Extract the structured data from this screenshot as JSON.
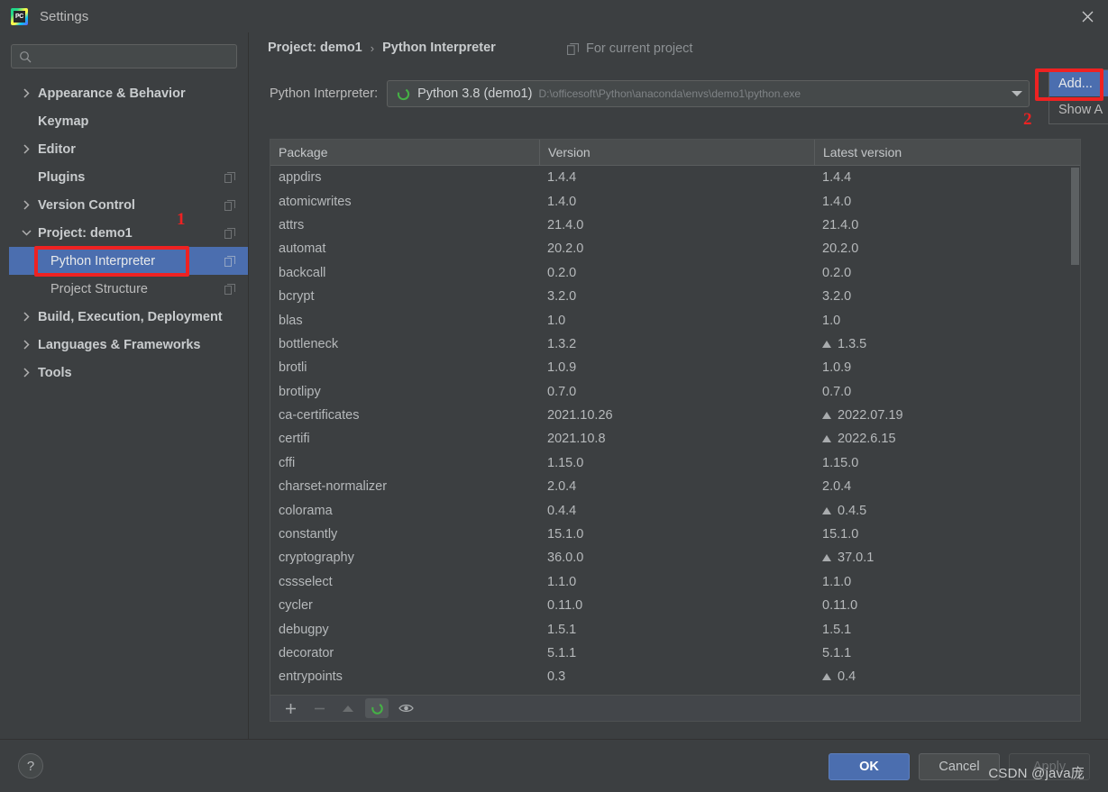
{
  "window": {
    "title": "Settings",
    "logo_text": "PC",
    "close_icon": "close-icon"
  },
  "sidebar": {
    "search": {
      "value": "",
      "placeholder": ""
    },
    "items": [
      {
        "label": "Appearance & Behavior",
        "arrow": "›",
        "bold": true,
        "child": false,
        "badge": false,
        "selected": false
      },
      {
        "label": "Keymap",
        "arrow": "",
        "bold": true,
        "child": false,
        "badge": false,
        "selected": false
      },
      {
        "label": "Editor",
        "arrow": "›",
        "bold": true,
        "child": false,
        "badge": false,
        "selected": false
      },
      {
        "label": "Plugins",
        "arrow": "",
        "bold": true,
        "child": false,
        "badge": true,
        "selected": false
      },
      {
        "label": "Version Control",
        "arrow": "›",
        "bold": true,
        "child": false,
        "badge": true,
        "selected": false
      },
      {
        "label": "Project: demo1",
        "arrow": "⌄",
        "bold": true,
        "child": false,
        "badge": true,
        "selected": false
      },
      {
        "label": "Python Interpreter",
        "arrow": "",
        "bold": false,
        "child": true,
        "badge": true,
        "selected": true
      },
      {
        "label": "Project Structure",
        "arrow": "",
        "bold": false,
        "child": true,
        "badge": true,
        "selected": false
      },
      {
        "label": "Build, Execution, Deployment",
        "arrow": "›",
        "bold": true,
        "child": false,
        "badge": false,
        "selected": false
      },
      {
        "label": "Languages & Frameworks",
        "arrow": "›",
        "bold": true,
        "child": false,
        "badge": false,
        "selected": false
      },
      {
        "label": "Tools",
        "arrow": "›",
        "bold": true,
        "child": false,
        "badge": false,
        "selected": false
      }
    ]
  },
  "main": {
    "breadcrumb": {
      "parent": "Project: demo1",
      "separator": "›",
      "current": "Python Interpreter"
    },
    "for_current_project": "For current project",
    "interpreter": {
      "label": "Python Interpreter:",
      "name": "Python 3.8 (demo1)",
      "path": "D:\\officesoft\\Python\\anaconda\\envs\\demo1\\python.exe"
    },
    "dropdown": {
      "items": [
        {
          "label": "Add...",
          "selected": true
        },
        {
          "label": "Show A",
          "selected": false
        }
      ]
    },
    "annotations": [
      {
        "number": "1"
      },
      {
        "number": "2"
      }
    ]
  },
  "packages": {
    "columns": [
      "Package",
      "Version",
      "Latest version"
    ],
    "rows": [
      {
        "name": "appdirs",
        "version": "1.4.4",
        "latest": "1.4.4",
        "upgrade": false
      },
      {
        "name": "atomicwrites",
        "version": "1.4.0",
        "latest": "1.4.0",
        "upgrade": false
      },
      {
        "name": "attrs",
        "version": "21.4.0",
        "latest": "21.4.0",
        "upgrade": false
      },
      {
        "name": "automat",
        "version": "20.2.0",
        "latest": "20.2.0",
        "upgrade": false
      },
      {
        "name": "backcall",
        "version": "0.2.0",
        "latest": "0.2.0",
        "upgrade": false
      },
      {
        "name": "bcrypt",
        "version": "3.2.0",
        "latest": "3.2.0",
        "upgrade": false
      },
      {
        "name": "blas",
        "version": "1.0",
        "latest": "1.0",
        "upgrade": false
      },
      {
        "name": "bottleneck",
        "version": "1.3.2",
        "latest": "1.3.5",
        "upgrade": true
      },
      {
        "name": "brotli",
        "version": "1.0.9",
        "latest": "1.0.9",
        "upgrade": false
      },
      {
        "name": "brotlipy",
        "version": "0.7.0",
        "latest": "0.7.0",
        "upgrade": false
      },
      {
        "name": "ca-certificates",
        "version": "2021.10.26",
        "latest": "2022.07.19",
        "upgrade": true
      },
      {
        "name": "certifi",
        "version": "2021.10.8",
        "latest": "2022.6.15",
        "upgrade": true
      },
      {
        "name": "cffi",
        "version": "1.15.0",
        "latest": "1.15.0",
        "upgrade": false
      },
      {
        "name": "charset-normalizer",
        "version": "2.0.4",
        "latest": "2.0.4",
        "upgrade": false
      },
      {
        "name": "colorama",
        "version": "0.4.4",
        "latest": "0.4.5",
        "upgrade": true
      },
      {
        "name": "constantly",
        "version": "15.1.0",
        "latest": "15.1.0",
        "upgrade": false
      },
      {
        "name": "cryptography",
        "version": "36.0.0",
        "latest": "37.0.1",
        "upgrade": true
      },
      {
        "name": "cssselect",
        "version": "1.1.0",
        "latest": "1.1.0",
        "upgrade": false
      },
      {
        "name": "cycler",
        "version": "0.11.0",
        "latest": "0.11.0",
        "upgrade": false
      },
      {
        "name": "debugpy",
        "version": "1.5.1",
        "latest": "1.5.1",
        "upgrade": false
      },
      {
        "name": "decorator",
        "version": "5.1.1",
        "latest": "5.1.1",
        "upgrade": false
      },
      {
        "name": "entrypoints",
        "version": "0.3",
        "latest": "0.4",
        "upgrade": true
      }
    ],
    "toolbar": {
      "add": "+",
      "remove": "−",
      "upgrade": "upgrade-arrow-icon",
      "interpreter": "python-ring-icon",
      "show_early": "eye-icon"
    }
  },
  "footer": {
    "help": "?",
    "ok": "OK",
    "cancel": "Cancel",
    "apply": "Apply",
    "watermark": "CSDN @java庞"
  },
  "colors": {
    "background": "#3c3f41",
    "selection": "#4b6eaf",
    "accent_green": "#3ea33e",
    "annotation_red": "#ee2222",
    "text": "#bbbbbb"
  }
}
